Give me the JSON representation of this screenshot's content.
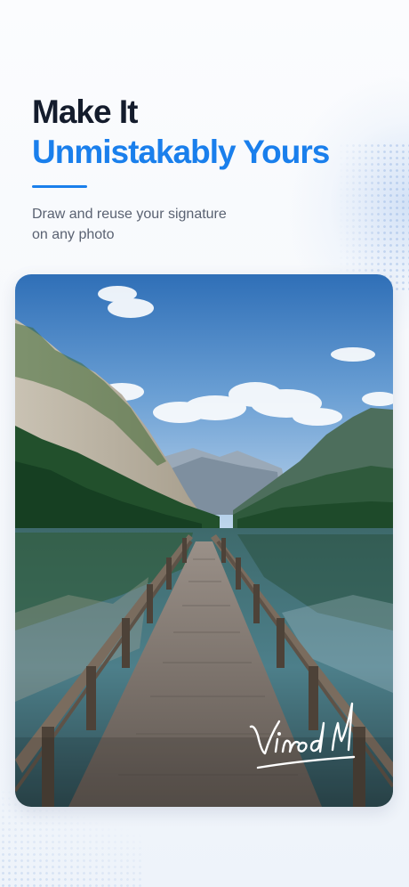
{
  "header": {
    "title_line1": "Make It",
    "title_line2": "Unmistakably Yours",
    "subtitle": "Draw and reuse your signature on any photo"
  },
  "photo": {
    "description_icon": "lake-pier-landscape-photo",
    "signature_text": "Vinod M"
  },
  "colors": {
    "accent": "#1a7fec",
    "title_dark": "#141c2c",
    "subtitle_gray": "#5a6272"
  }
}
